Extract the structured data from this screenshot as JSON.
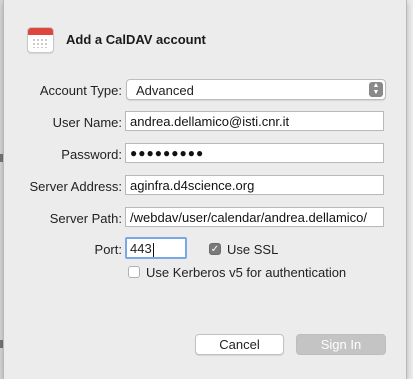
{
  "dialog": {
    "title": "Add a CalDAV account",
    "icon": "calendar-icon"
  },
  "form": {
    "account_type": {
      "label": "Account Type:",
      "value": "Advanced"
    },
    "user_name": {
      "label": "User Name:",
      "value": "andrea.dellamico@isti.cnr.it"
    },
    "password": {
      "label": "Password:",
      "value": "●●●●●●●●●"
    },
    "server_address": {
      "label": "Server Address:",
      "value": "aginfra.d4science.org"
    },
    "server_path": {
      "label": "Server Path:",
      "value": "/webdav/user/calendar/andrea.dellamico/"
    },
    "port": {
      "label": "Port:",
      "value": "443"
    },
    "use_ssl": {
      "label": "Use SSL",
      "checked": true
    },
    "kerberos": {
      "label": "Use Kerberos v5 for authentication",
      "checked": false
    }
  },
  "buttons": {
    "cancel": "Cancel",
    "sign_in": "Sign In"
  },
  "colors": {
    "sheet_background": "#ececec",
    "focus_ring": "#7aa7e6",
    "disabled_button": "#c4c4c4",
    "calendar_red": "#e0453d"
  }
}
